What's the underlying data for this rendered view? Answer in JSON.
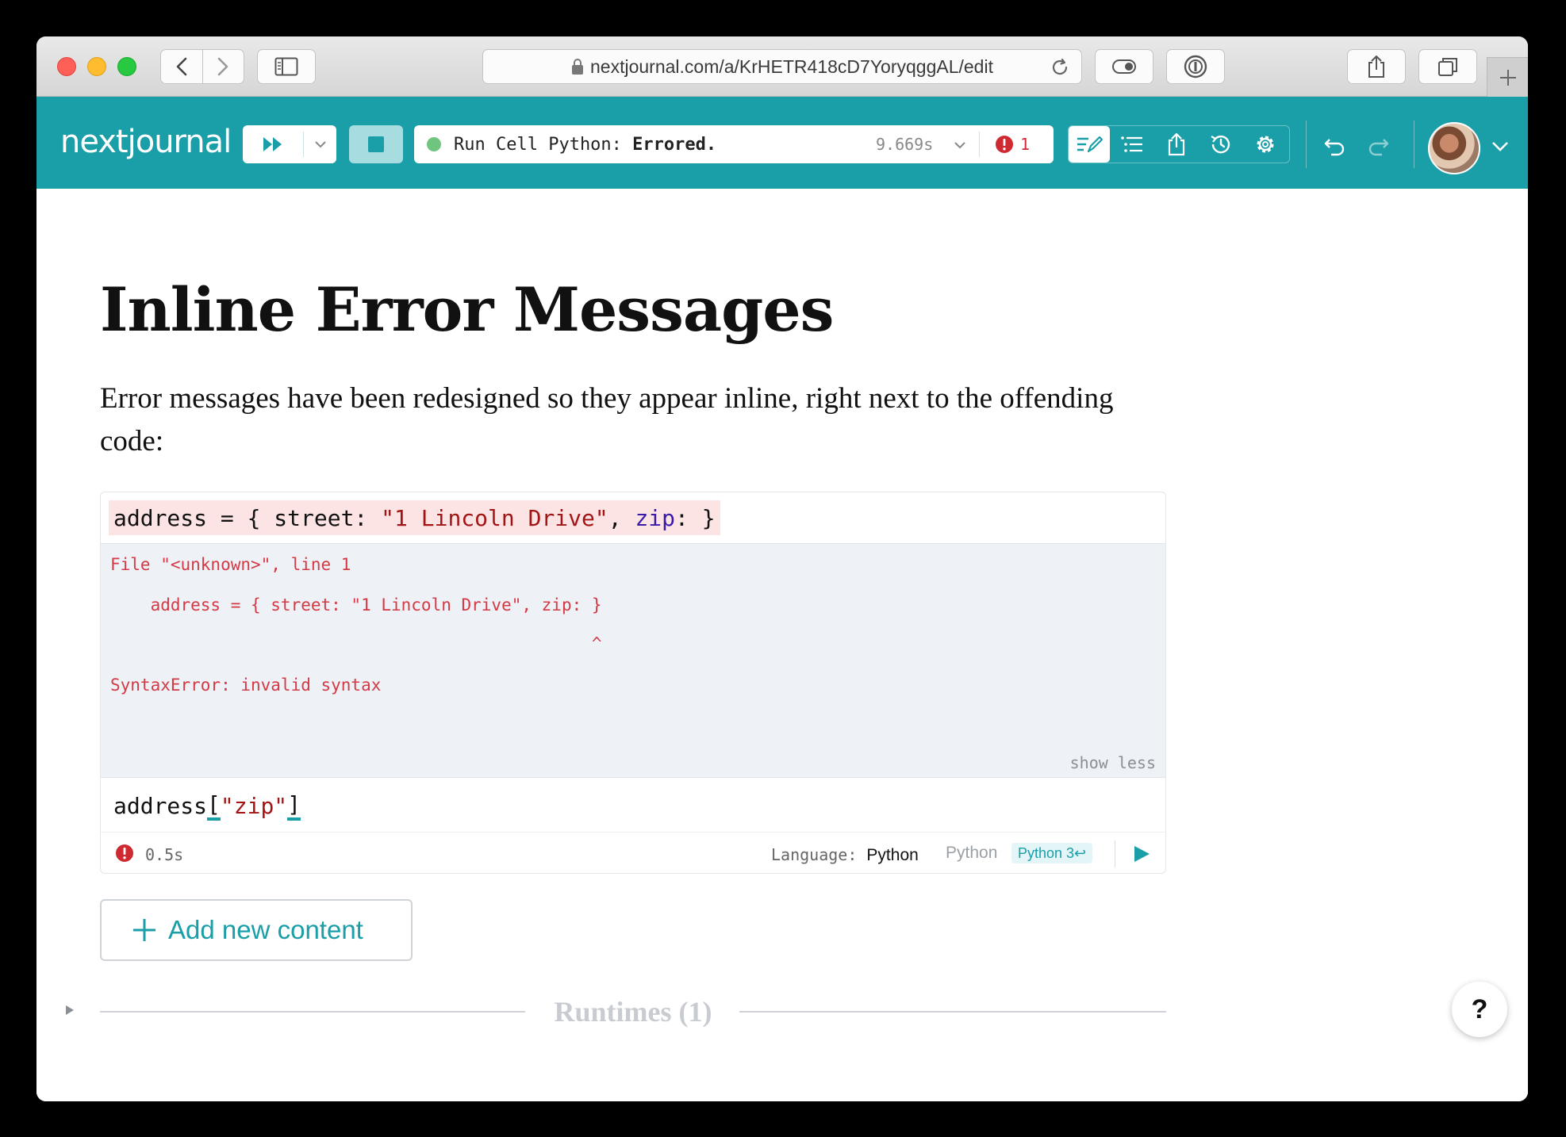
{
  "browser": {
    "url": "nextjournal.com/a/KrHETR418cD7YoryqggAL/edit"
  },
  "toolbar": {
    "logo": "nextjournal",
    "status_prefix": "Run Cell Python: ",
    "status_state": "Errored.",
    "duration": "9.669s",
    "error_count": "1",
    "accent_color": "#1a9ea7"
  },
  "document": {
    "title": "Inline Error Messages",
    "paragraph": "Error messages have been redesigned so they appear inline, right next to the offending code:"
  },
  "cell": {
    "code_line1": {
      "plain1": "address = { street: ",
      "string1": "\"1 Lincoln Drive\"",
      "plain2": ", ",
      "keyword": "zip",
      "plain3": ": }"
    },
    "error_lines": [
      "File \"<unknown>\", line 1",
      "    address = { street: \"1 Lincoln Drive\", zip: }",
      "                                                ^",
      "SyntaxError: invalid syntax"
    ],
    "show_less": "show less",
    "code_line2": {
      "plain": "address",
      "bracket_open": "[",
      "string": "\"zip\"",
      "bracket_close": "]"
    },
    "footer": {
      "duration": "0.5s",
      "language_label": "Language:",
      "language": "Python",
      "runtime_label": "Python",
      "runtime_badge": "Python 3↩"
    }
  },
  "add_content": "Add new content",
  "runtimes": "Runtimes (1)",
  "help": "?"
}
